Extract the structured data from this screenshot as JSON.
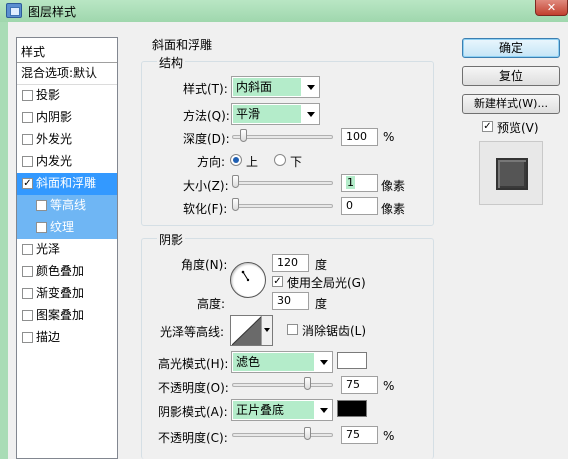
{
  "window": {
    "title": "图层样式",
    "close_glyph": "✕"
  },
  "style_list": {
    "header": "样式",
    "blend_options": "混合选项:默认",
    "items": [
      {
        "label": "投影",
        "checked": false,
        "selected": false,
        "sub": false
      },
      {
        "label": "内阴影",
        "checked": false,
        "selected": false,
        "sub": false
      },
      {
        "label": "外发光",
        "checked": false,
        "selected": false,
        "sub": false
      },
      {
        "label": "内发光",
        "checked": false,
        "selected": false,
        "sub": false
      },
      {
        "label": "斜面和浮雕",
        "checked": true,
        "selected": true,
        "sub": false
      },
      {
        "label": "等高线",
        "checked": false,
        "selected": false,
        "sub": true
      },
      {
        "label": "纹理",
        "checked": false,
        "selected": false,
        "sub": true
      },
      {
        "label": "光泽",
        "checked": false,
        "selected": false,
        "sub": false
      },
      {
        "label": "颜色叠加",
        "checked": false,
        "selected": false,
        "sub": false
      },
      {
        "label": "渐变叠加",
        "checked": false,
        "selected": false,
        "sub": false
      },
      {
        "label": "图案叠加",
        "checked": false,
        "selected": false,
        "sub": false
      },
      {
        "label": "描边",
        "checked": false,
        "selected": false,
        "sub": false
      }
    ]
  },
  "bevel": {
    "group_title": "斜面和浮雕",
    "structure_title": "结构",
    "style_label": "样式(T):",
    "style_value": "内斜面",
    "method_label": "方法(Q):",
    "method_value": "平滑",
    "depth_label": "深度(D):",
    "depth_value": "100",
    "depth_unit": "%",
    "depth_level": 0.1,
    "direction_label": "方向:",
    "direction_up": "上",
    "direction_down": "下",
    "direction_selected": "上",
    "size_label": "大小(Z):",
    "size_value": "1",
    "size_unit": "像素",
    "size_level": 0.0,
    "soften_label": "软化(F):",
    "soften_value": "0",
    "soften_unit": "像素",
    "soften_level": 0.0
  },
  "shading": {
    "group_title": "阴影",
    "angle_label": "角度(N):",
    "angle_value": "120",
    "angle_unit": "度",
    "global_light_label": "使用全局光(G)",
    "global_light_checked": true,
    "altitude_label": "高度:",
    "altitude_value": "30",
    "altitude_unit": "度",
    "gloss_label": "光泽等高线:",
    "antialias_label": "消除锯齿(L)",
    "antialias_checked": false,
    "highlight_mode_label": "高光模式(H):",
    "highlight_mode_value": "滤色",
    "highlight_color": "#ffffff",
    "highlight_opacity_label": "不透明度(O):",
    "highlight_opacity_value": "75",
    "highlight_opacity_unit": "%",
    "highlight_opacity_level": 0.75,
    "shadow_mode_label": "阴影模式(A):",
    "shadow_mode_value": "正片叠底",
    "shadow_color": "#000000",
    "shadow_opacity_label": "不透明度(C):",
    "shadow_opacity_value": "75",
    "shadow_opacity_unit": "%",
    "shadow_opacity_level": 0.75
  },
  "buttons": {
    "ok": "确定",
    "reset": "复位",
    "new_style": "新建样式(W)...",
    "preview_label": "预览(V)",
    "preview_checked": true
  }
}
